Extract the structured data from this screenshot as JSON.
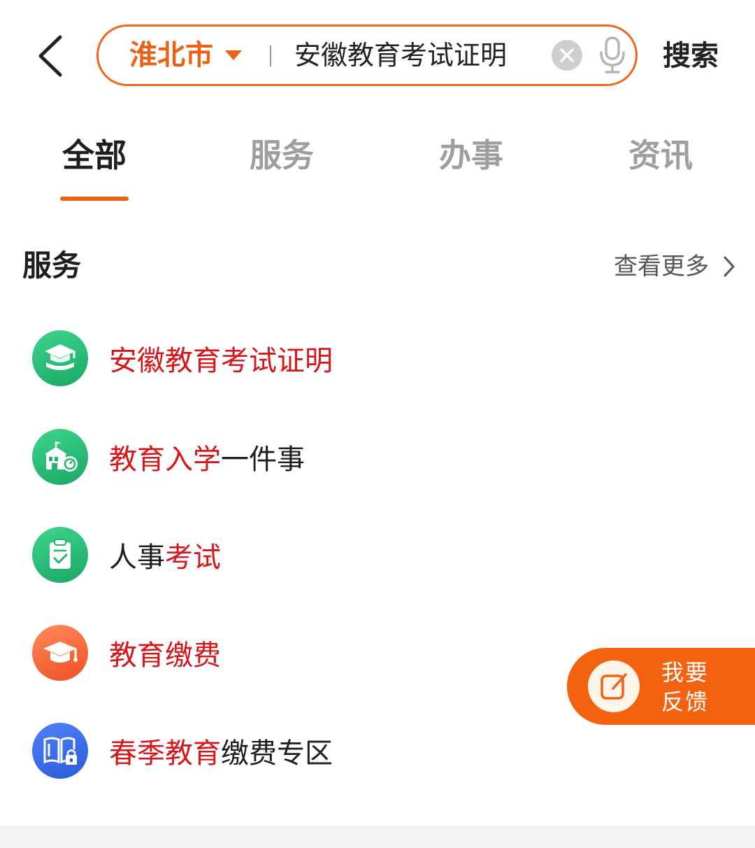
{
  "search": {
    "city": "淮北市",
    "query": "安徽教育考试证明",
    "search_label": "搜索"
  },
  "tabs": [
    {
      "label": "全部",
      "active": true
    },
    {
      "label": "服务",
      "active": false
    },
    {
      "label": "办事",
      "active": false
    },
    {
      "label": "资讯",
      "active": false
    }
  ],
  "section": {
    "title": "服务",
    "more_label": "查看更多"
  },
  "services": [
    {
      "parts": [
        {
          "text": "安徽教育考试证明",
          "hl": true
        }
      ],
      "icon": "graduation-book-icon"
    },
    {
      "parts": [
        {
          "text": "教育入学",
          "hl": true
        },
        {
          "text": "一件事",
          "hl": false
        }
      ],
      "icon": "school-building-icon"
    },
    {
      "parts": [
        {
          "text": "人事",
          "hl": false
        },
        {
          "text": "考试",
          "hl": true
        }
      ],
      "icon": "checklist-icon"
    },
    {
      "parts": [
        {
          "text": "教育缴费",
          "hl": true
        }
      ],
      "icon": "graduation-cap-icon"
    },
    {
      "parts": [
        {
          "text": "春季教育",
          "hl": true
        },
        {
          "text": "缴费专区",
          "hl": false
        }
      ],
      "icon": "open-book-lock-icon"
    }
  ],
  "feedback": {
    "line1": "我要",
    "line2": "反馈"
  },
  "colors": {
    "accent": "#ec5f14",
    "highlight": "#d6161a",
    "text": "#1e1e1e",
    "tab_inactive": "#9e9e9e"
  }
}
